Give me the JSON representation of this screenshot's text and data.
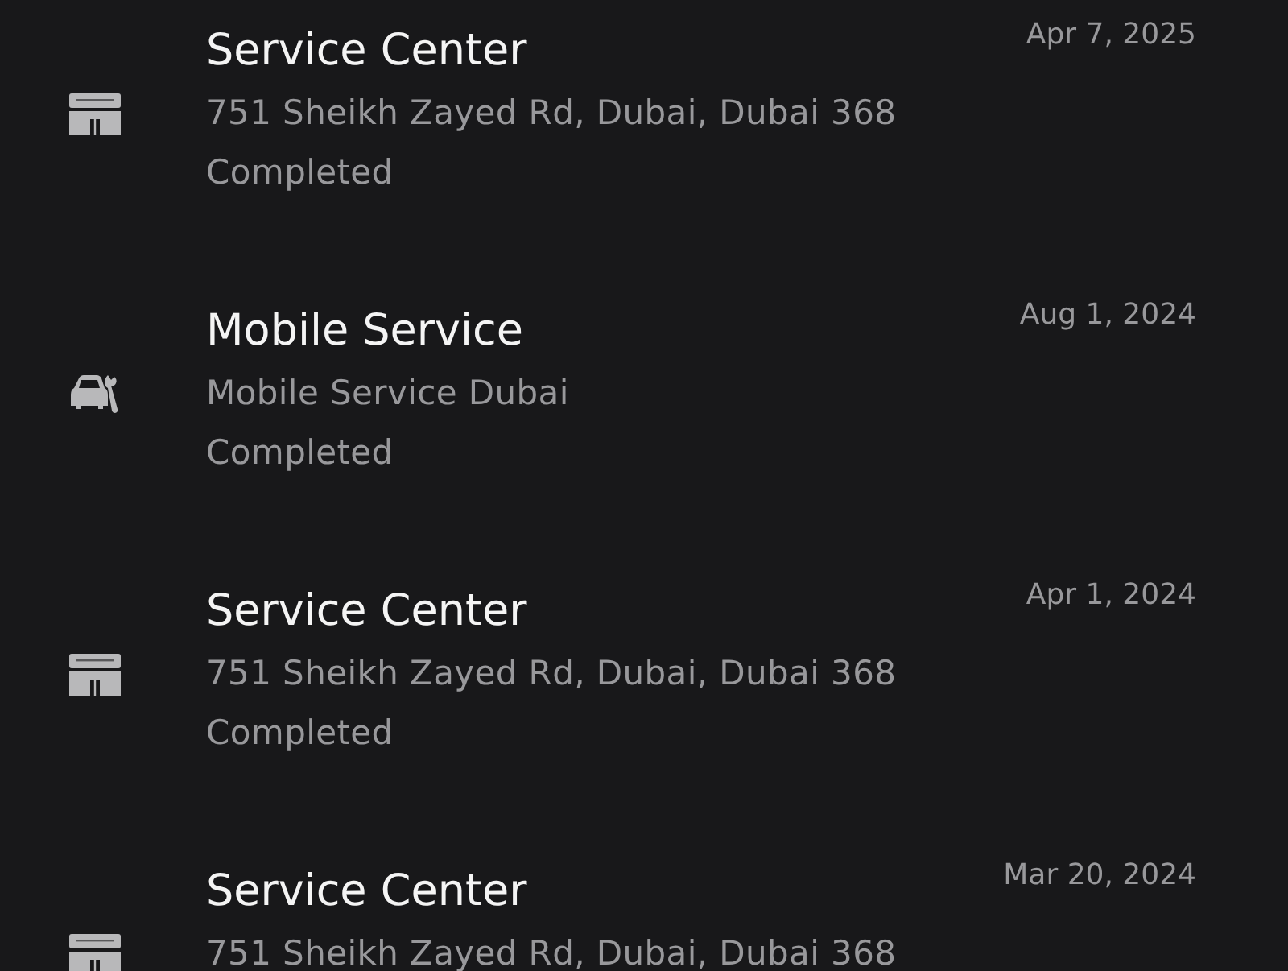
{
  "appointments": [
    {
      "kind": "service_center",
      "title": "Service Center",
      "location": "751 Sheikh Zayed Rd, Dubai, Dubai 368",
      "status": "Completed",
      "date": "Apr 7, 2025"
    },
    {
      "kind": "mobile_service",
      "title": "Mobile Service",
      "location": "Mobile Service Dubai",
      "status": "Completed",
      "date": "Aug 1, 2024"
    },
    {
      "kind": "service_center",
      "title": "Service Center",
      "location": "751 Sheikh Zayed Rd, Dubai, Dubai 368",
      "status": "Completed",
      "date": "Apr 1, 2024"
    },
    {
      "kind": "service_center",
      "title": "Service Center",
      "location": "751 Sheikh Zayed Rd, Dubai, Dubai 368",
      "date": "Mar 20, 2024"
    }
  ]
}
